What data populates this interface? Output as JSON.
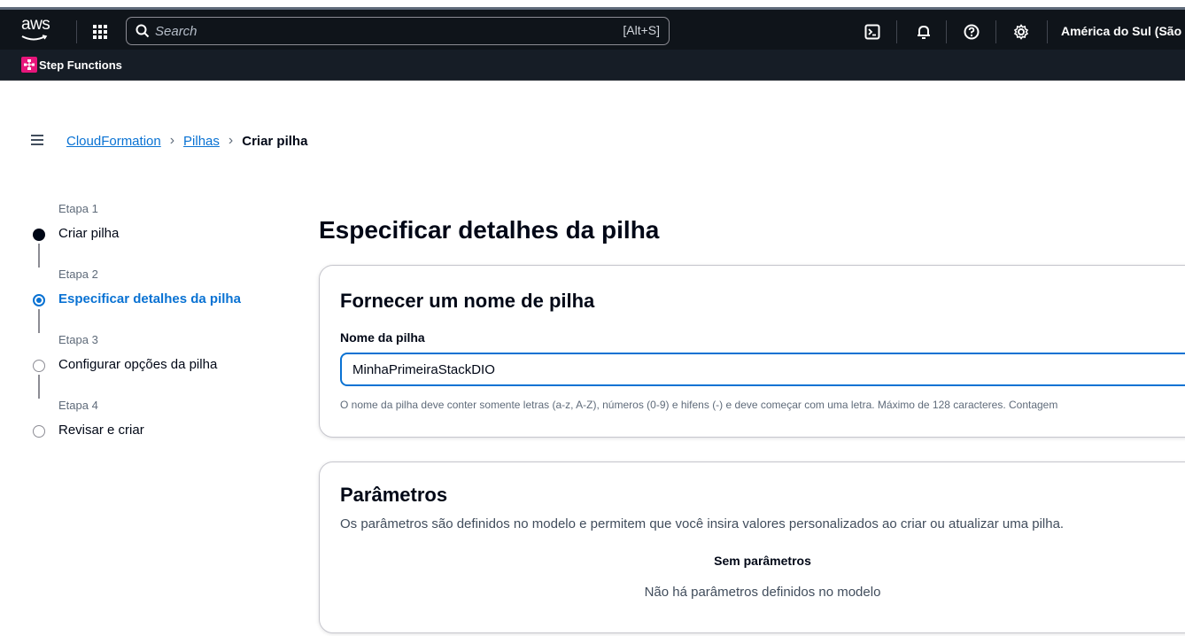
{
  "topbar": {
    "logo_text": "aws",
    "search_placeholder": "Search",
    "search_shortcut": "[Alt+S]",
    "region": "América do Sul (São"
  },
  "favorites": {
    "service_label": "Step Functions"
  },
  "breadcrumb": {
    "items": [
      "CloudFormation",
      "Pilhas"
    ],
    "current": "Criar pilha"
  },
  "steps": [
    {
      "etapa": "Etapa 1",
      "title": "Criar pilha",
      "state": "done"
    },
    {
      "etapa": "Etapa 2",
      "title": "Especificar detalhes da pilha",
      "state": "active"
    },
    {
      "etapa": "Etapa 3",
      "title": "Configurar opções da pilha",
      "state": "pending"
    },
    {
      "etapa": "Etapa 4",
      "title": "Revisar e criar",
      "state": "pending"
    }
  ],
  "main": {
    "page_title": "Especificar detalhes da pilha",
    "name_card": {
      "heading": "Fornecer um nome de pilha",
      "field_label": "Nome da pilha",
      "field_value": "MinhaPrimeiraStackDIO",
      "hint": "O nome da pilha deve conter somente letras (a-z, A-Z), números (0-9) e hifens (-) e deve começar com uma letra. Máximo de 128 caracteres. Contagem"
    },
    "params_card": {
      "heading": "Parâmetros",
      "description": "Os parâmetros são definidos no modelo e permitem que você insira valores personalizados ao criar ou atualizar uma pilha.",
      "empty_title": "Sem parâmetros",
      "empty_description": "Não há parâmetros definidos no modelo"
    }
  },
  "colors": {
    "topbar_bg": "#0f141a",
    "accent": "#0972d3",
    "step_functions_badge": "#e7157b"
  },
  "icons": [
    "grid-icon",
    "search-icon",
    "cloudshell-icon",
    "bell-icon",
    "help-icon",
    "gear-icon",
    "menu-icon",
    "step-functions-icon"
  ]
}
